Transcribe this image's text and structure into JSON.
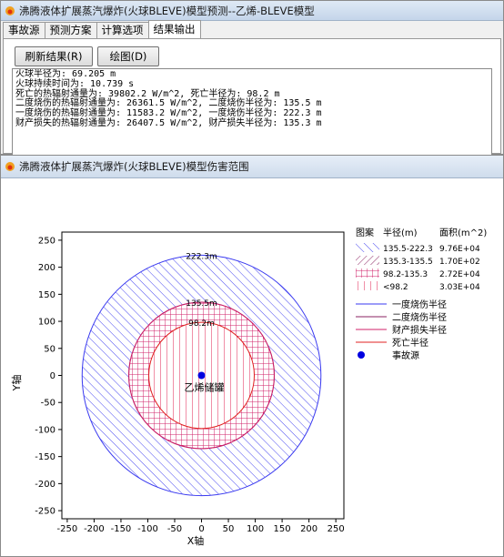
{
  "window_main": {
    "title": "沸腾液体扩展蒸汽爆炸(火球BLEVE)模型预测--乙烯-BLEVE模型",
    "tabs": [
      "事故源",
      "预测方案",
      "计算选项",
      "结果输出"
    ],
    "active_tab": "结果输出",
    "buttons": {
      "refresh": "刷新结果(R)",
      "plot": "绘图(D)"
    },
    "output_lines": [
      "火球半径为: 69.205 m",
      "火球持续时间为: 10.739 s",
      "死亡的热辐射通量为: 39802.2 W/m^2, 死亡半径为: 98.2 m",
      "二度烧伤的热辐射通量为: 26361.5 W/m^2, 二度烧伤半径为: 135.5 m",
      "一度烧伤的热辐射通量为: 11583.2 W/m^2, 一度烧伤半径为: 222.3 m",
      "财产损失的热辐射通量为: 26407.5 W/m^2, 财产损失半径为: 135.3 m"
    ]
  },
  "window_plot": {
    "title": "沸腾液体扩展蒸汽爆炸(火球BLEVE)模型伤害范围"
  },
  "chart_data": {
    "type": "scatter",
    "xlabel": "X轴",
    "ylabel": "Y轴",
    "xlim": [
      -260,
      265
    ],
    "ylim": [
      -265,
      265
    ],
    "ticks": [
      -250,
      -200,
      -150,
      -100,
      -50,
      0,
      50,
      100,
      150,
      200,
      250
    ],
    "circles": [
      {
        "radius": 222.3,
        "label": "222.3m",
        "color": "#3a3af0",
        "name": "一度烧伤半径"
      },
      {
        "radius": 135.5,
        "label": "135.5m",
        "color": "#8a2060",
        "name": "二度烧伤半径"
      },
      {
        "radius": 135.3,
        "label": "135.5m",
        "color": "#d0206a",
        "name": "财产损失半径"
      },
      {
        "radius": 98.2,
        "label": "98.2m",
        "color": "#e02020",
        "name": "死亡半径"
      }
    ],
    "source": {
      "x": 0,
      "y": 0,
      "label": "乙烯储罐",
      "name": "事故源"
    },
    "legend": {
      "placement": "right",
      "header": [
        "图案",
        "半径(m)",
        "面积(m^2)"
      ],
      "fills": [
        {
          "range": "135.5-222.3",
          "area": "9.76E+04",
          "pattern": "diag-blue"
        },
        {
          "range": "135.3-135.5",
          "area": "1.70E+02",
          "pattern": "diag-purple"
        },
        {
          "range": "98.2-135.3",
          "area": "2.72E+04",
          "pattern": "grid-pink"
        },
        {
          "range": "<98.2",
          "area": "3.03E+04",
          "pattern": "vert-pink"
        }
      ],
      "lines": [
        {
          "label": "一度烧伤半径",
          "color": "#3a3af0"
        },
        {
          "label": "二度烧伤半径",
          "color": "#8a2060"
        },
        {
          "label": "财产损失半径",
          "color": "#d0206a"
        },
        {
          "label": "死亡半径",
          "color": "#e02020"
        }
      ],
      "marker": {
        "label": "事故源",
        "color": "#0000e0"
      }
    }
  }
}
